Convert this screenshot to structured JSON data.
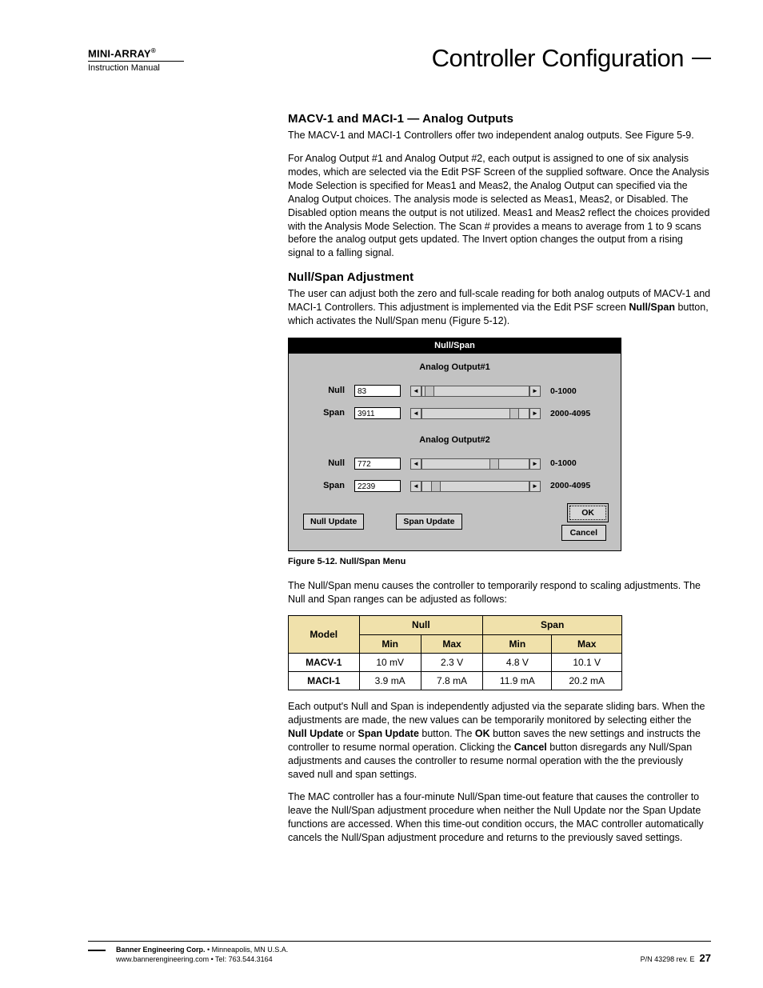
{
  "header": {
    "brand": "MINI-ARRAY",
    "brand_sup": "®",
    "subtitle": "Instruction Manual",
    "title": "Controller Configuration"
  },
  "section1": {
    "heading": "MACV-1 and MACI-1 — Analog Outputs",
    "p1": "The MACV-1 and MACI-1 Controllers offer two independent analog outputs. See Figure 5-9.",
    "p2": "For Analog Output #1 and Analog Output #2, each output is assigned to one of six analysis modes, which are selected via the Edit PSF Screen of the supplied software. Once the Analysis Mode Selection is specified for Meas1 and Meas2, the Analog Output can specified via the Analog Output choices. The analysis mode is selected as Meas1, Meas2, or Disabled. The Disabled option means the output is not utilized. Meas1 and Meas2 reflect the choices provided with the Analysis Mode Selection. The Scan # provides a means to average from 1 to 9 scans before the analog output gets updated. The Invert option changes the output from a rising signal to a falling signal."
  },
  "section2": {
    "heading": "Null/Span Adjustment",
    "p1a": "The user can adjust both the zero and full-scale reading for both analog outputs of MACV-1 and MACI-1 Controllers. This adjustment is implemented via the Edit PSF screen ",
    "p1b": "Null/Span",
    "p1c": " button, which activates the Null/Span menu (Figure 5-12)."
  },
  "dialog": {
    "title": "Null/Span",
    "ao1_label": "Analog Output#1",
    "ao2_label": "Analog Output#2",
    "null_label": "Null",
    "span_label": "Span",
    "ao1_null_value": "83",
    "ao1_null_range": "0-1000",
    "ao1_span_value": "3911",
    "ao1_span_range": "2000-4095",
    "ao2_null_value": "772",
    "ao2_null_range": "0-1000",
    "ao2_span_value": "2239",
    "ao2_span_range": "2000-4095",
    "null_update": "Null Update",
    "span_update": "Span Update",
    "ok": "OK",
    "cancel": "Cancel"
  },
  "fig_caption": "Figure 5-12.  Null/Span Menu",
  "after_fig_p": "The Null/Span menu causes the controller to temporarily respond to scaling adjustments. The Null and Span ranges can be adjusted as follows:",
  "table": {
    "h_model": "Model",
    "h_null": "Null",
    "h_span": "Span",
    "h_min": "Min",
    "h_max": "Max",
    "rows": [
      {
        "model": "MACV-1",
        "null_min": "10 mV",
        "null_max": "2.3 V",
        "span_min": "4.8 V",
        "span_max": "10.1 V"
      },
      {
        "model": "MACI-1",
        "null_min": "3.9 mA",
        "null_max": "7.8 mA",
        "span_min": "11.9 mA",
        "span_max": "20.2 mA"
      }
    ]
  },
  "p_after_table_parts": {
    "a": "Each output's Null and Span is independently adjusted via the separate sliding bars. When the adjustments are made, the new values can be temporarily monitored by selecting either the ",
    "b": "Null Update",
    "c": " or ",
    "d": "Span Update",
    "e": " button. The ",
    "f": "OK",
    "g": " button saves the new settings and instructs the controller to resume normal operation. Clicking the ",
    "h": "Cancel",
    "i": " button disregards any Null/Span adjustments and causes the controller to resume normal operation with the the previously saved null and span settings."
  },
  "p_last": "The MAC controller has a four-minute Null/Span time-out feature that causes the controller to leave the Null/Span adjustment procedure when neither the Null Update nor the Span Update functions are accessed. When this time-out condition occurs, the MAC controller automatically cancels the Null/Span adjustment procedure and returns to the previously saved settings.",
  "footer": {
    "line1a": "Banner Engineering Corp.",
    "line1b": " • Minneapolis, MN U.S.A.",
    "line2": "www.bannerengineering.com  •  Tel: 763.544.3164",
    "pn": "P/N 43298 rev. E",
    "page": "27"
  }
}
